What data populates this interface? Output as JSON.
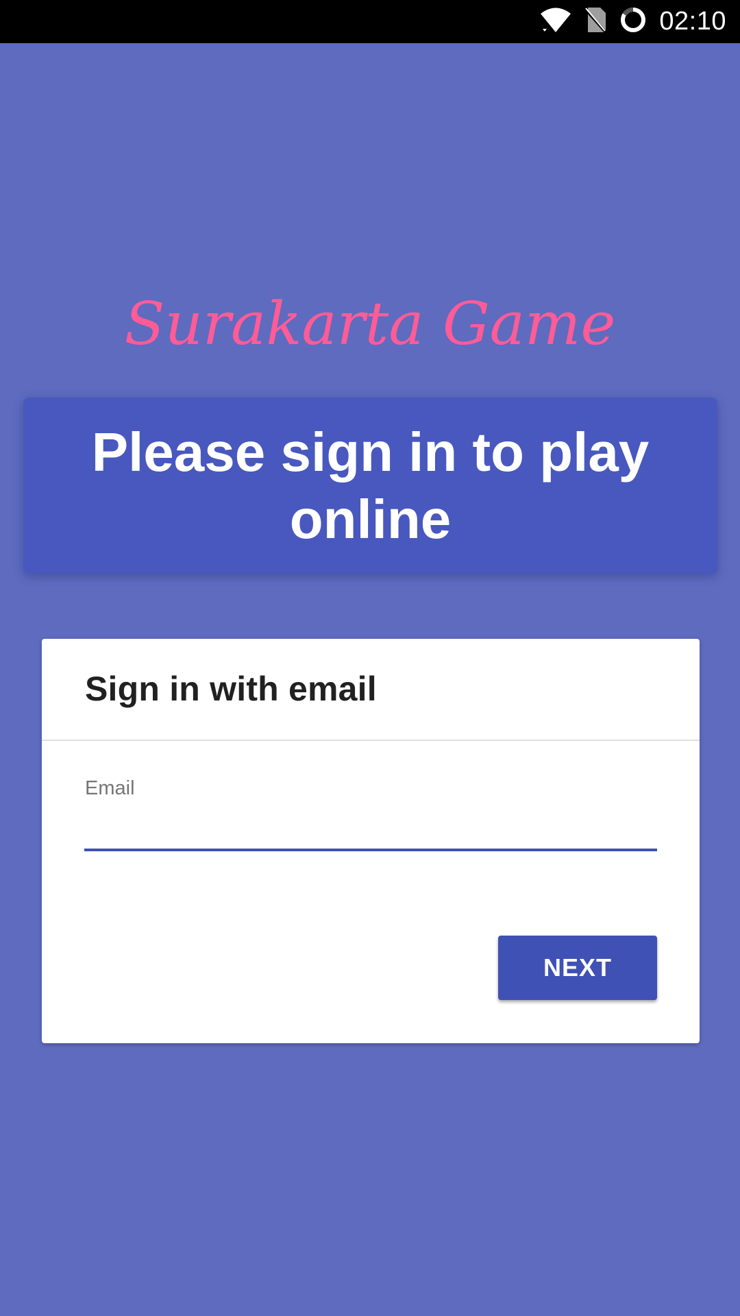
{
  "status_bar": {
    "time": "02:10",
    "icons": [
      "wifi-icon",
      "no-sim-icon",
      "loading-ring-icon"
    ]
  },
  "app": {
    "title": "Surakarta Game",
    "title_color": "#ff5c97",
    "background_color": "#5e6bbf"
  },
  "banner": {
    "text": "Please sign in to play online",
    "color": "#4858be"
  },
  "sign_in_card": {
    "title": "Sign in with email",
    "email_label": "Email",
    "email_value": "",
    "next_label": "NEXT",
    "accent_color": "#3f51b5"
  }
}
